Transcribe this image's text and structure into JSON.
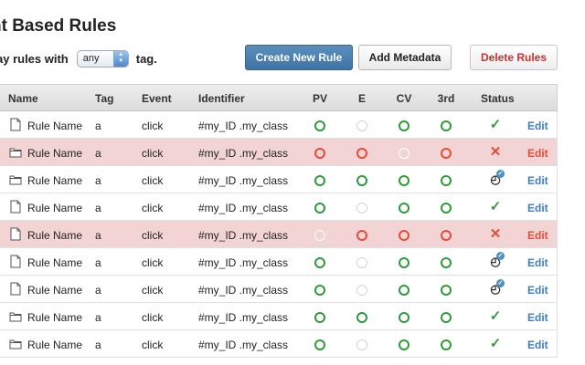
{
  "page": {
    "title": "nt Based Rules"
  },
  "filter": {
    "prefix": "ay rules with",
    "select_value": "any",
    "suffix": "tag."
  },
  "buttons": {
    "create": "Create New Rule",
    "metadata": "Add Metadata",
    "delete": "Delete Rules"
  },
  "table": {
    "columns": [
      "Name",
      "Tag",
      "Event",
      "Identifier",
      "PV",
      "E",
      "CV",
      "3rd",
      "Status"
    ],
    "edit_label": "Edit",
    "rows": [
      {
        "icon": "document-icon",
        "name": "Rule Name",
        "tag": "a",
        "event": "click",
        "identifier": "#my_ID .my_class",
        "pv": "ok",
        "e": "empty",
        "cv": "ok",
        "third": "ok",
        "status": "active",
        "state": "normal"
      },
      {
        "icon": "folder-icon",
        "name": "Rule Name",
        "tag": "a",
        "event": "click",
        "identifier": "#my_ID .my_class",
        "pv": "error",
        "e": "error",
        "cv": "empty",
        "third": "error",
        "status": "failed",
        "state": "error"
      },
      {
        "icon": "folder-icon",
        "name": "Rule Name",
        "tag": "a",
        "event": "click",
        "identifier": "#my_ID .my_class",
        "pv": "ok",
        "e": "ok",
        "cv": "ok",
        "third": "ok",
        "status": "pending",
        "state": "normal"
      },
      {
        "icon": "document-icon",
        "name": "Rule Name",
        "tag": "a",
        "event": "click",
        "identifier": "#my_ID .my_class",
        "pv": "ok",
        "e": "empty",
        "cv": "ok",
        "third": "ok",
        "status": "active",
        "state": "normal"
      },
      {
        "icon": "document-icon",
        "name": "Rule Name",
        "tag": "a",
        "event": "click",
        "identifier": "#my_ID .my_class",
        "pv": "empty",
        "e": "error",
        "cv": "error",
        "third": "error",
        "status": "failed",
        "state": "error"
      },
      {
        "icon": "document-icon",
        "name": "Rule Name",
        "tag": "a",
        "event": "click",
        "identifier": "#my_ID .my_class",
        "pv": "ok",
        "e": "empty",
        "cv": "ok",
        "third": "ok",
        "status": "pending",
        "state": "normal"
      },
      {
        "icon": "document-icon",
        "name": "Rule Name",
        "tag": "a",
        "event": "click",
        "identifier": "#my_ID .my_class",
        "pv": "ok",
        "e": "empty",
        "cv": "ok",
        "third": "ok",
        "status": "pending",
        "state": "normal"
      },
      {
        "icon": "folder-icon",
        "name": "Rule Name",
        "tag": "a",
        "event": "click",
        "identifier": "#my_ID .my_class",
        "pv": "ok",
        "e": "ok",
        "cv": "ok",
        "third": "ok",
        "status": "active",
        "state": "normal"
      },
      {
        "icon": "folder-icon",
        "name": "Rule Name",
        "tag": "a",
        "event": "click",
        "identifier": "#my_ID .my_class",
        "pv": "ok",
        "e": "empty",
        "cv": "ok",
        "third": "ok",
        "status": "active",
        "state": "normal"
      }
    ]
  },
  "colors": {
    "ok": "#2e9a3a",
    "error": "#e54b3c",
    "error_row_bg": "#f3d4d4",
    "link": "#3d7fbf",
    "primary_button": "#4a7fb0"
  }
}
